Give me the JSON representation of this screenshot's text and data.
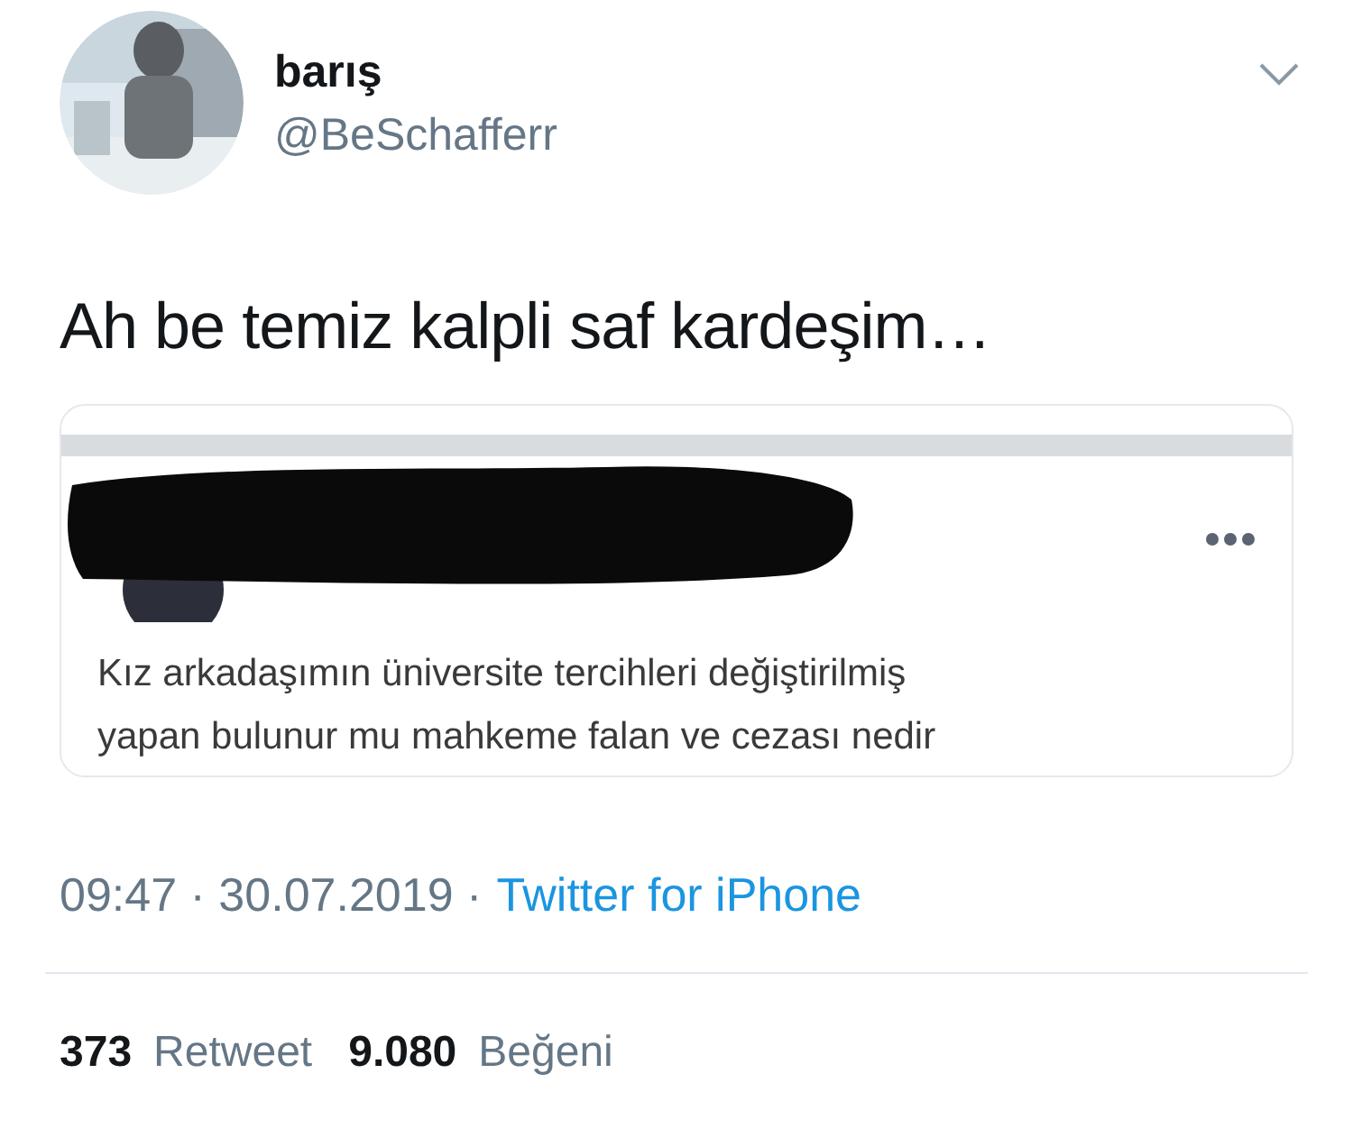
{
  "author": {
    "name": "barış",
    "handle": "@BeSchafferr"
  },
  "tweet_text": "Ah be temiz kalpli saf kardeşim…",
  "embedded": {
    "lines": [
      "Kız arkadaşımın üniversite tercihleri değiştirilmiş",
      "yapan bulunur mu mahkeme falan ve cezası nedir"
    ]
  },
  "meta": {
    "timestamp": "09:47 · 30.07.2019 ·",
    "source": "Twitter for iPhone"
  },
  "stats": [
    {
      "count": "373",
      "label": "Retweet"
    },
    {
      "count": "9.080",
      "label": "Beğeni"
    }
  ]
}
